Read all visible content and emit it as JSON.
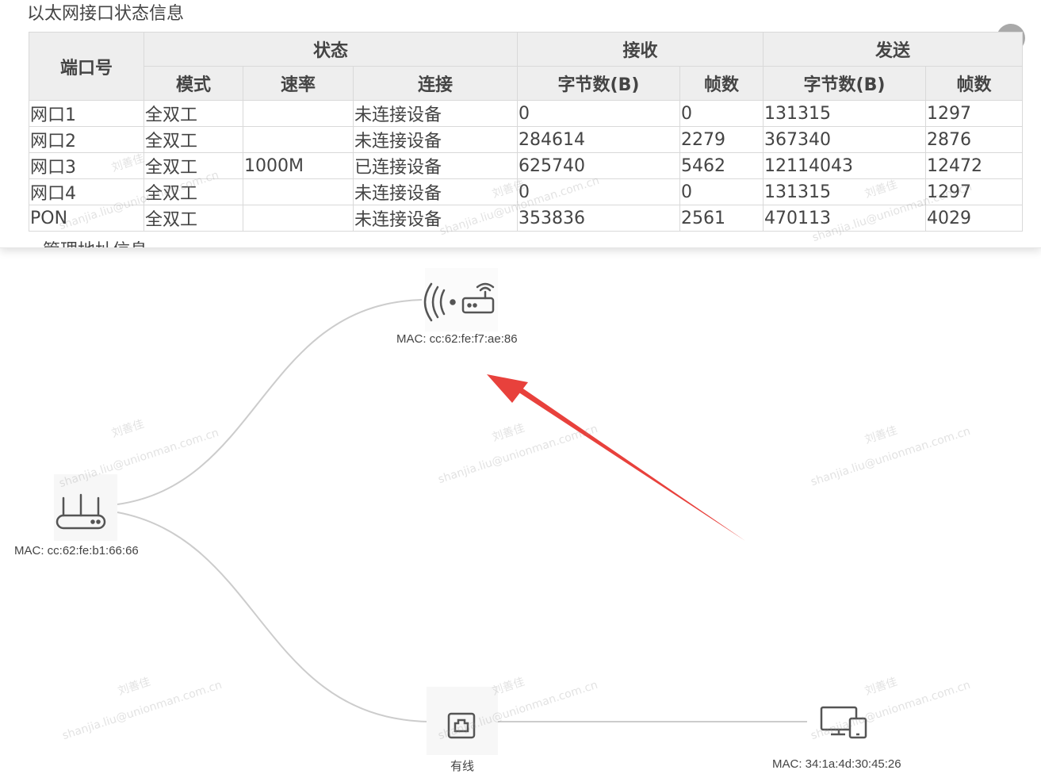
{
  "panel": {
    "section_title": "以太网接口状态信息",
    "next_section_title": "管理地址信息",
    "close_glyph": "✕"
  },
  "table": {
    "col_port": "端口号",
    "group_status": "状态",
    "group_receive": "接收",
    "group_send": "发送",
    "sub_mode": "模式",
    "sub_rate": "速率",
    "sub_connection": "连接",
    "sub_rx_bytes": "字节数(B)",
    "sub_rx_frames": "帧数",
    "sub_tx_bytes": "字节数(B)",
    "sub_tx_frames": "帧数",
    "rows": [
      [
        "网口1",
        "全双工",
        "",
        "未连接设备",
        "0",
        "0",
        "131315",
        "1297"
      ],
      [
        "网口2",
        "全双工",
        "",
        "未连接设备",
        "284614",
        "2279",
        "367340",
        "2876"
      ],
      [
        "网口3",
        "全双工",
        "1000M",
        "已连接设备",
        "625740",
        "5462",
        "12114043",
        "12472"
      ],
      [
        "网口4",
        "全双工",
        "",
        "未连接设备",
        "0",
        "0",
        "131315",
        "1297"
      ],
      [
        "PON",
        "全双工",
        "",
        "未连接设备",
        "353836",
        "2561",
        "470113",
        "4029"
      ]
    ]
  },
  "topology": {
    "router_mac": "MAC: cc:62:fe:b1:66:66",
    "wireless_ap_mac": "MAC: cc:62:fe:f7:ae:86",
    "wired_label": "有线",
    "device_mac": "MAC: 34:1a:4d:30:45:26",
    "link_color": "#cccccc",
    "icon_color": "#555555",
    "arrow_color": "#e8413c"
  },
  "watermarks": {
    "name": "刘善佳",
    "email": "shanjia.liu@unionman.com.cn"
  }
}
